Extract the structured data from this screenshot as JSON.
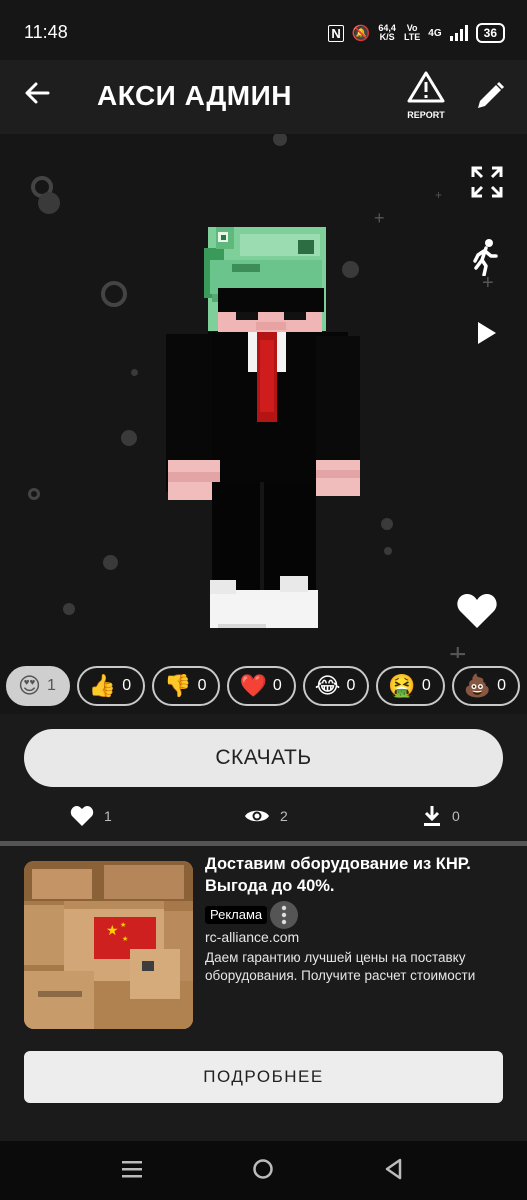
{
  "status": {
    "time": "11:48",
    "speed_value": "64,4",
    "speed_unit": "K/S",
    "volte_top": "Vo",
    "volte_bottom": "LTE",
    "network": "4G",
    "battery": "36"
  },
  "header": {
    "title": "АКСИ АДМИН",
    "report_label": "REPORT"
  },
  "reactions": [
    {
      "icon": "heart-eyes-emoji",
      "emoji": "😍",
      "count": "1",
      "active": true
    },
    {
      "icon": "thumbs-up-emoji",
      "emoji": "👍",
      "count": "0",
      "active": false
    },
    {
      "icon": "thumbs-down-emoji",
      "emoji": "👎",
      "count": "0",
      "active": false
    },
    {
      "icon": "red-heart-emoji",
      "emoji": "❤️",
      "count": "0",
      "active": false
    },
    {
      "icon": "tears-of-joy-emoji",
      "emoji": "😂",
      "count": "0",
      "active": false
    },
    {
      "icon": "nauseated-emoji",
      "emoji": "🤮",
      "count": "0",
      "active": false
    },
    {
      "icon": "poop-emoji",
      "emoji": "💩",
      "count": "0",
      "active": false
    }
  ],
  "download": {
    "button_label": "СКАЧАТЬ"
  },
  "stats": {
    "likes": "1",
    "views": "2",
    "downloads": "0"
  },
  "ad": {
    "title": "Доставим оборудование из КНР. Выгода до 40%.",
    "badge": "Реклама",
    "domain": "rc-alliance.com",
    "description": "Даем гарантию лучшей цены на поставку оборудования. Получите расчет стоимости",
    "button_label": "ПОДРОБНЕЕ"
  },
  "colors": {
    "background": "#1b1b1b",
    "viewer": "#161616",
    "button": "#e8e8e8",
    "tie": "#c01818"
  }
}
